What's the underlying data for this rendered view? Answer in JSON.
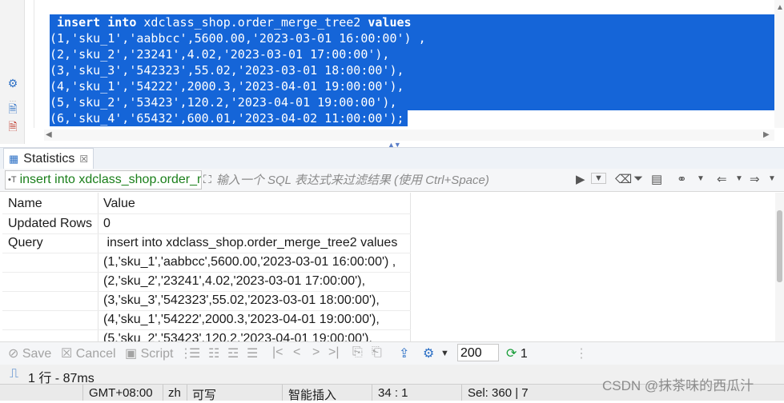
{
  "editor": {
    "lines": [
      {
        "kw1": "insert",
        "kw2": "into",
        "mid": " xdclass_shop.order_merge_tree2 ",
        "kw3": "values"
      },
      {
        "text": "(1,'sku_1','aabbcc',5600.00,'2023-03-01 16:00:00') ,"
      },
      {
        "text": "(2,'sku_2','23241',4.02,'2023-03-01 17:00:00'),"
      },
      {
        "text": "(3,'sku_3','542323',55.02,'2023-03-01 18:00:00'),"
      },
      {
        "text": "(4,'sku_1','54222',2000.3,'2023-04-01 19:00:00'),"
      },
      {
        "text": "(5,'sku_2','53423',120.2,'2023-04-01 19:00:00'),"
      },
      {
        "text": "(6,'sku_4','65432',600.01,'2023-04-02 11:00:00');"
      }
    ],
    "selection_color": "#1565d8"
  },
  "results": {
    "tab_label": "Statistics",
    "query_text": "insert into xdclass_shop.order_merge_tree2 values",
    "filter_placeholder": "输入一个 SQL 表达式来过滤结果 (使用 Ctrl+Space)",
    "columns": {
      "name": "Name",
      "value": "Value"
    },
    "rows": [
      {
        "name": "Updated Rows",
        "value": "0"
      },
      {
        "name": "Query",
        "value": " insert into xdclass_shop.order_merge_tree2 values"
      },
      {
        "name": "",
        "value": "(1,'sku_1','aabbcc',5600.00,'2023-03-01 16:00:00') ,"
      },
      {
        "name": "",
        "value": "(2,'sku_2','23241',4.02,'2023-03-01 17:00:00'),"
      },
      {
        "name": "",
        "value": "(3,'sku_3','542323',55.02,'2023-03-01 18:00:00'),"
      },
      {
        "name": "",
        "value": "(4,'sku_1','54222',2000.3,'2023-04-01 19:00:00'),"
      },
      {
        "name": "",
        "value": "(5,'sku_2','53423',120.2,'2023-04-01 19:00:00'),"
      }
    ]
  },
  "toolbar": {
    "save_label": "Save",
    "cancel_label": "Cancel",
    "script_label": "Script",
    "fetch_size": "200",
    "refresh_count": "1"
  },
  "status": {
    "summary": "1 行 - 87ms",
    "timezone": "GMT+08:00",
    "locale": "zh",
    "mode": "可写",
    "insert_mode": "智能插入",
    "cursor": "34 : 1",
    "selection": "Sel: 360 | 7"
  },
  "watermark": "CSDN @抹茶味的西瓜汁"
}
